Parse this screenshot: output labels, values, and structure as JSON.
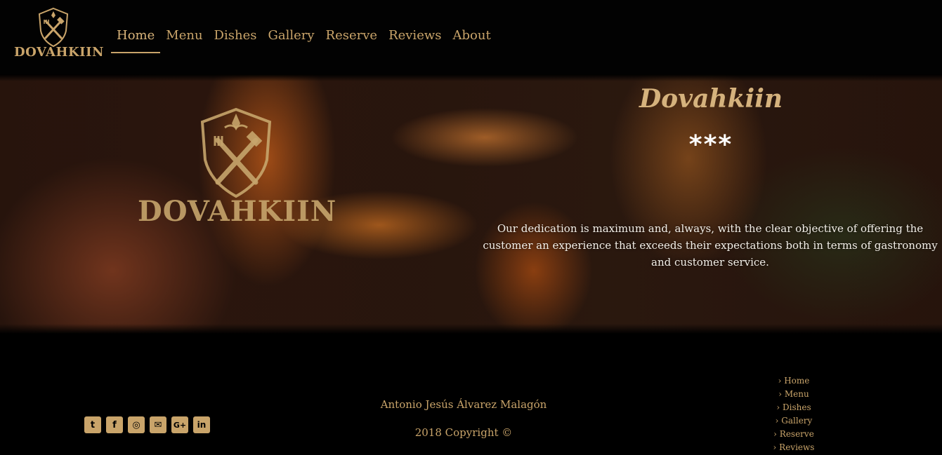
{
  "brand": {
    "logo_text": "DOVAHKIIN",
    "accent_color": "#c9a46a"
  },
  "nav": {
    "items": [
      {
        "label": "Home",
        "active": true
      },
      {
        "label": "Menu"
      },
      {
        "label": "Dishes"
      },
      {
        "label": "Gallery"
      },
      {
        "label": "Reserve"
      },
      {
        "label": "Reviews"
      },
      {
        "label": "About"
      }
    ]
  },
  "hero": {
    "logo_text": "DOVAHKIIN",
    "title": "Dovahkiin",
    "stars": "***",
    "description": "Our dedication is maximum and, always, with the clear objective of offering the customer an experience that exceeds their expectations both in terms of gastronomy and customer service."
  },
  "footer": {
    "socials": [
      {
        "icon": "twitter-icon",
        "glyph": "t"
      },
      {
        "icon": "facebook-icon",
        "glyph": "f"
      },
      {
        "icon": "instagram-icon",
        "glyph": "◎"
      },
      {
        "icon": "envelope-icon",
        "glyph": "✉"
      },
      {
        "icon": "google-plus-icon",
        "glyph": "G+"
      },
      {
        "icon": "linkedin-icon",
        "glyph": "in"
      }
    ],
    "author": "Antonio Jesús Álvarez Malagón",
    "copyright": "2018 Copyright ©",
    "links": [
      {
        "label": "› Home"
      },
      {
        "label": "› Menu"
      },
      {
        "label": "› Dishes"
      },
      {
        "label": "› Gallery"
      },
      {
        "label": "› Reserve"
      },
      {
        "label": "› Reviews"
      }
    ]
  }
}
